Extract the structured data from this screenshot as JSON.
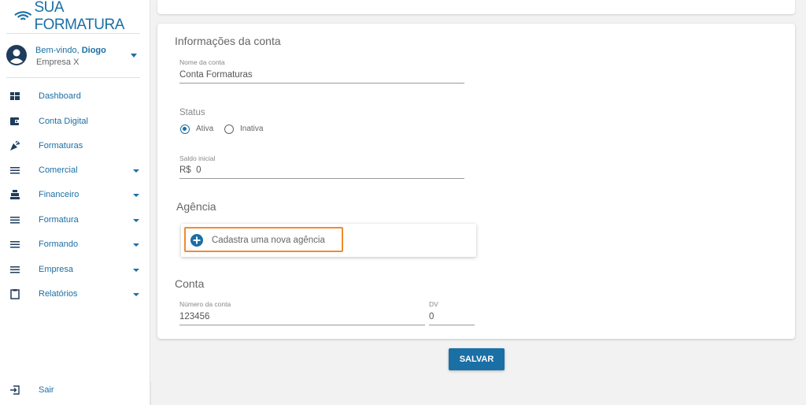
{
  "brand": {
    "name": "SUA FORMATURA",
    "color": "#1a6fa5"
  },
  "user": {
    "welcome": "Bem-vindo, ",
    "name": "Diogo",
    "company": "Empresa X"
  },
  "sidebar": {
    "items": [
      {
        "label": "Dashboard",
        "icon": "dashboard-icon",
        "expandable": false
      },
      {
        "label": "Conta Digital",
        "icon": "wallet-icon",
        "expandable": false
      },
      {
        "label": "Formaturas",
        "icon": "party-popper-icon",
        "expandable": false
      },
      {
        "label": "Comercial",
        "icon": "menu-icon",
        "expandable": true
      },
      {
        "label": "Financeiro",
        "icon": "cash-register-icon",
        "expandable": true
      },
      {
        "label": "Formatura",
        "icon": "menu-icon",
        "expandable": true
      },
      {
        "label": "Formando",
        "icon": "menu-icon",
        "expandable": true
      },
      {
        "label": "Empresa",
        "icon": "menu-icon",
        "expandable": true
      },
      {
        "label": "Relatórios",
        "icon": "clipboard-icon",
        "expandable": true
      }
    ],
    "logout": {
      "label": "Sair",
      "icon": "logout-icon"
    }
  },
  "form": {
    "account_section": {
      "title": "Informações da conta",
      "name_label": "Nome da conta",
      "name_value": "Conta Formaturas",
      "status_label": "Status",
      "status_options": [
        "Ativa",
        "Inativa"
      ],
      "status_selected": "Ativa",
      "balance_label": "Saldo inicial",
      "balance_prefix": "R$",
      "balance_value": "0"
    },
    "agency_section": {
      "title": "Agência",
      "new_agency_label": "Cadastra uma nova agência"
    },
    "conta_section": {
      "title": "Conta",
      "number_label": "Número da conta",
      "number_value": "123456",
      "dv_label": "DV",
      "dv_value": "0"
    },
    "save_label": "SALVAR"
  },
  "colors": {
    "accent": "#1a6fa5",
    "highlight": "#f08a32"
  }
}
